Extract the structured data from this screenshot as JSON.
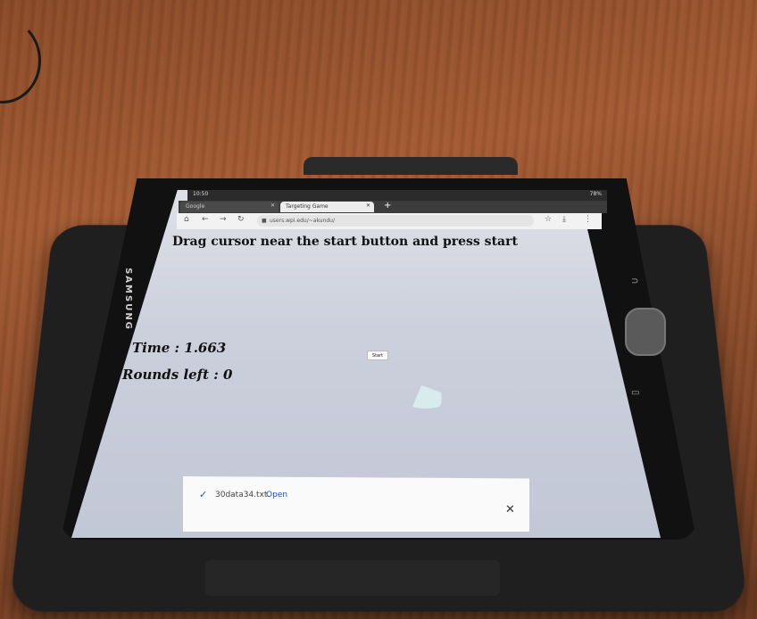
{
  "status_bar": {
    "time": "10:50",
    "battery": "78%"
  },
  "tabs": [
    {
      "label": "Google"
    },
    {
      "label": "Targeting Game"
    }
  ],
  "new_tab": "+",
  "url": "users.wpi.edu/~akundu/",
  "page": {
    "instruction": "Drag cursor near the start button and press start",
    "time_text": "Time : 1.663",
    "rounds_text": "Rounds left : 0",
    "start_label": "Start"
  },
  "download": {
    "filename": "30data34.txt.",
    "open_label": "Open",
    "close_icon": "✕"
  },
  "device": {
    "brand": "SAMSUNG"
  },
  "colors": {
    "target": "#d7ecec",
    "link": "#1a4fd6"
  }
}
